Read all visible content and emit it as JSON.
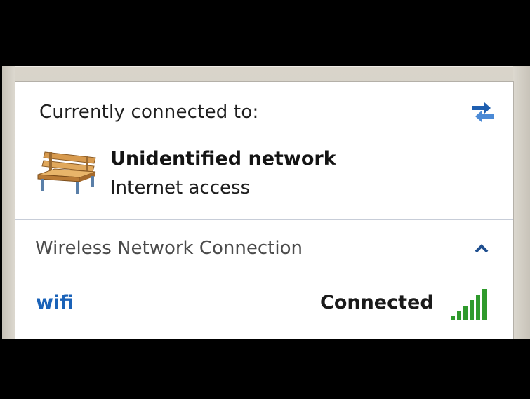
{
  "panel": {
    "currently_label": "Currently connected to:",
    "refresh_icon": "refresh-arrows-icon"
  },
  "network": {
    "icon": "public-bench-network-icon",
    "name": "Unidentified network",
    "access": "Internet access"
  },
  "connection_section": {
    "label": "Wireless Network Connection",
    "collapse_icon": "chevron-up-icon"
  },
  "wifi": {
    "name": "wifi",
    "status": "Connected",
    "signal_icon": "signal-strength-icon",
    "signal_level": 1.0
  },
  "colors": {
    "link_blue": "#1a62b8",
    "signal_green": "#2f9a2c",
    "accent_blue": "#1f5fb0"
  }
}
